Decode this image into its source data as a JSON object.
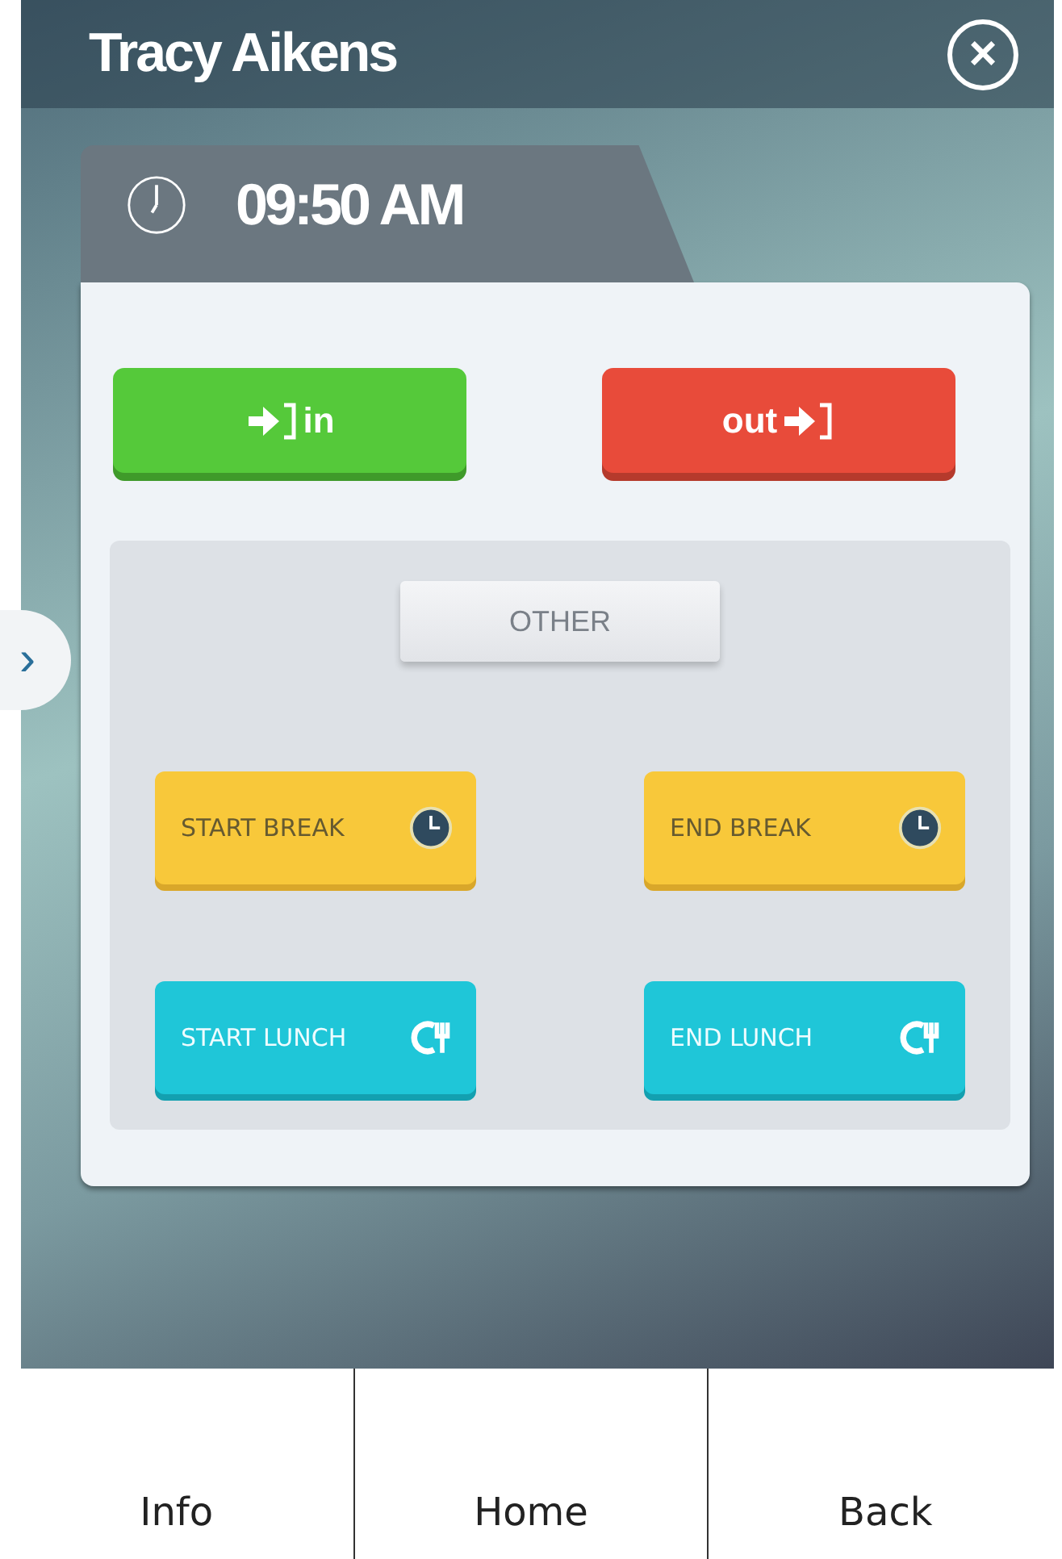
{
  "header": {
    "title": "Tracy Aikens",
    "close_icon": "×"
  },
  "clock": {
    "time": "09:50 AM"
  },
  "punch_buttons": [
    {
      "kind": "in",
      "label": "in"
    },
    {
      "kind": "out",
      "label": "out"
    }
  ],
  "other": {
    "label": "OTHER"
  },
  "side_tab": {
    "glyph": "›"
  },
  "actions": [
    {
      "kind": "break",
      "label": "START BREAK"
    },
    {
      "kind": "break",
      "label": "END BREAK"
    },
    {
      "kind": "lunch",
      "label": "START LUNCH"
    },
    {
      "kind": "lunch",
      "label": "END LUNCH"
    }
  ],
  "nav": [
    {
      "label": "Info"
    },
    {
      "label": "Home"
    },
    {
      "label": "Back"
    }
  ]
}
